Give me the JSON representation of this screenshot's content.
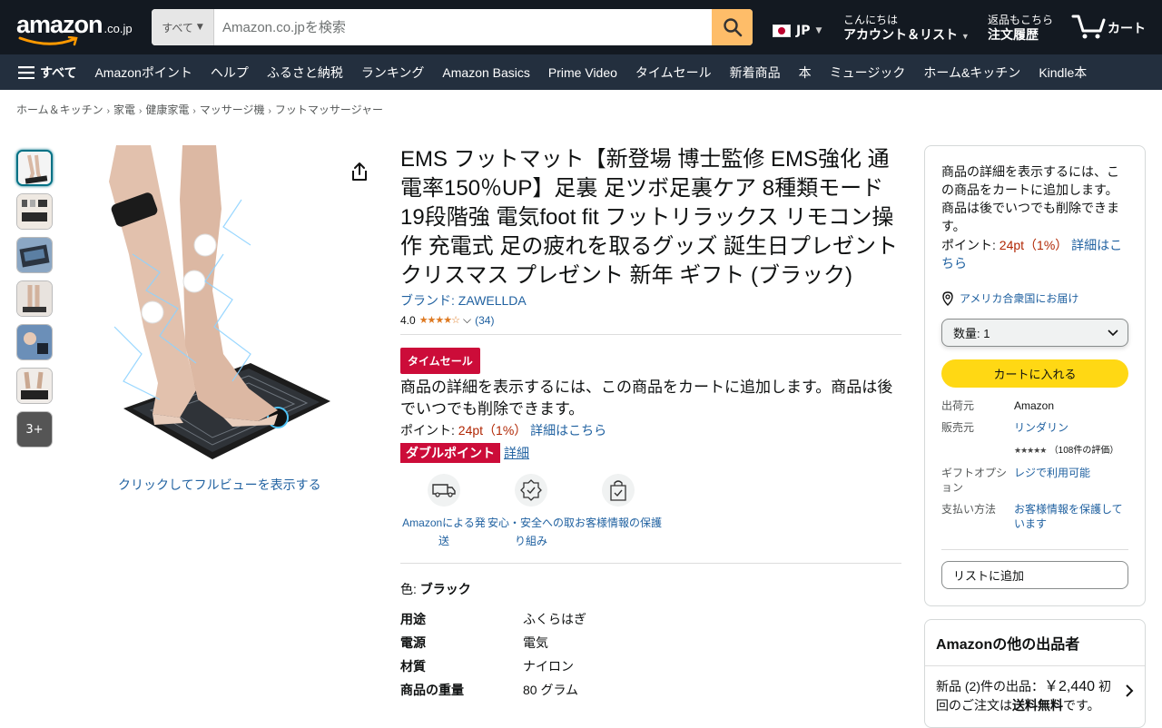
{
  "header": {
    "logo_word": "amazon",
    "logo_domain": ".co.jp",
    "search_category": "すべて",
    "search_placeholder": "Amazon.co.jpを検索",
    "language": "JP",
    "account_greeting": "こんにちは",
    "account_label": "アカウント＆リスト",
    "orders_line1": "返品もこちら",
    "orders_line2": "注文履歴",
    "cart_label": "カート"
  },
  "nav": {
    "all_label": "すべて",
    "items": [
      "Amazonポイント",
      "ヘルプ",
      "ふるさと納税",
      "ランキング",
      "Amazon Basics",
      "Prime Video",
      "タイムセール",
      "新着商品",
      "本",
      "ミュージック",
      "ホーム&キッチン",
      "Kindle本"
    ]
  },
  "breadcrumb": [
    "ホーム＆キッチン",
    "家電",
    "健康家電",
    "マッサージ機",
    "フットマッサージャー"
  ],
  "gallery": {
    "more_label": "3+",
    "fullview_label": "クリックしてフルビューを表示する"
  },
  "product": {
    "title": "EMS フットマット【新登場 博士監修 EMS強化 通電率150％UP】足裏 足ツボ足裏ケア 8種類モード 19段階強 電気foot fit フットリラックス リモコン操作 充電式 足の疲れを取るグッズ 誕生日プレゼント クリスマス プレゼント 新年 ギフト (ブラック)",
    "brand_label": "ブランド: ZAWELLDA",
    "rating_value": "4.0",
    "rating_stars": 4.0,
    "rating_count": "(34)",
    "sale_badge": "タイムセール",
    "cart_message": "商品の詳細を表示するには、この商品をカートに追加します。商品は後でいつでも削除できます。",
    "points_prefix": "ポイント: ",
    "points_value": "24pt（1%）",
    "points_link": "詳細はこちら",
    "double_points": "ダブルポイント",
    "double_points_link": "詳細",
    "features": [
      {
        "icon": "truck-icon",
        "label": "Amazonによる発送"
      },
      {
        "icon": "shield-badge-icon",
        "label": "安心・安全への取り組み"
      },
      {
        "icon": "secure-bag-icon",
        "label": "お客様情報の保護"
      }
    ],
    "color_label": "色: ",
    "color_value": "ブラック",
    "specs": [
      {
        "key": "用途",
        "value": "ふくらはぎ"
      },
      {
        "key": "電源",
        "value": "電気"
      },
      {
        "key": "材質",
        "value": "ナイロン"
      },
      {
        "key": "商品の重量",
        "value": "80 グラム"
      }
    ]
  },
  "buybox": {
    "message": "商品の詳細を表示するには、この商品をカートに追加します。商品は後でいつでも削除できます。",
    "points_prefix": "ポイント: ",
    "points_value": "24pt（1%）",
    "points_link": "詳細はこちら",
    "deliver_to": "アメリカ合衆国にお届け",
    "quantity_label": "数量: 1",
    "add_to_cart": "カートに入れる",
    "ships_from_label": "出荷元",
    "ships_from_value": "Amazon",
    "sold_by_label": "販売元",
    "sold_by_value": "リンダリン",
    "seller_rating_count": "（108件の評価）",
    "gift_label": "ギフトオプション",
    "gift_value": "レジで利用可能",
    "payment_label": "支払い方法",
    "payment_value": "お客様情報を保護しています",
    "add_to_list": "リストに追加"
  },
  "other_sellers": {
    "heading": "Amazonの他の出品者",
    "text_prefix": "新品 (2)件の出品：",
    "price": "￥2,440",
    "text_suffix": "初回のご注文は",
    "bold": "送料無料",
    "text_end": "です。"
  },
  "colors": {
    "header_bg": "#131921",
    "nav_bg": "#232f3e",
    "search_button": "#febd69",
    "add_to_cart": "#ffd814",
    "sale_red": "#cc0c39",
    "link": "#2162a1",
    "star": "#de7921"
  }
}
